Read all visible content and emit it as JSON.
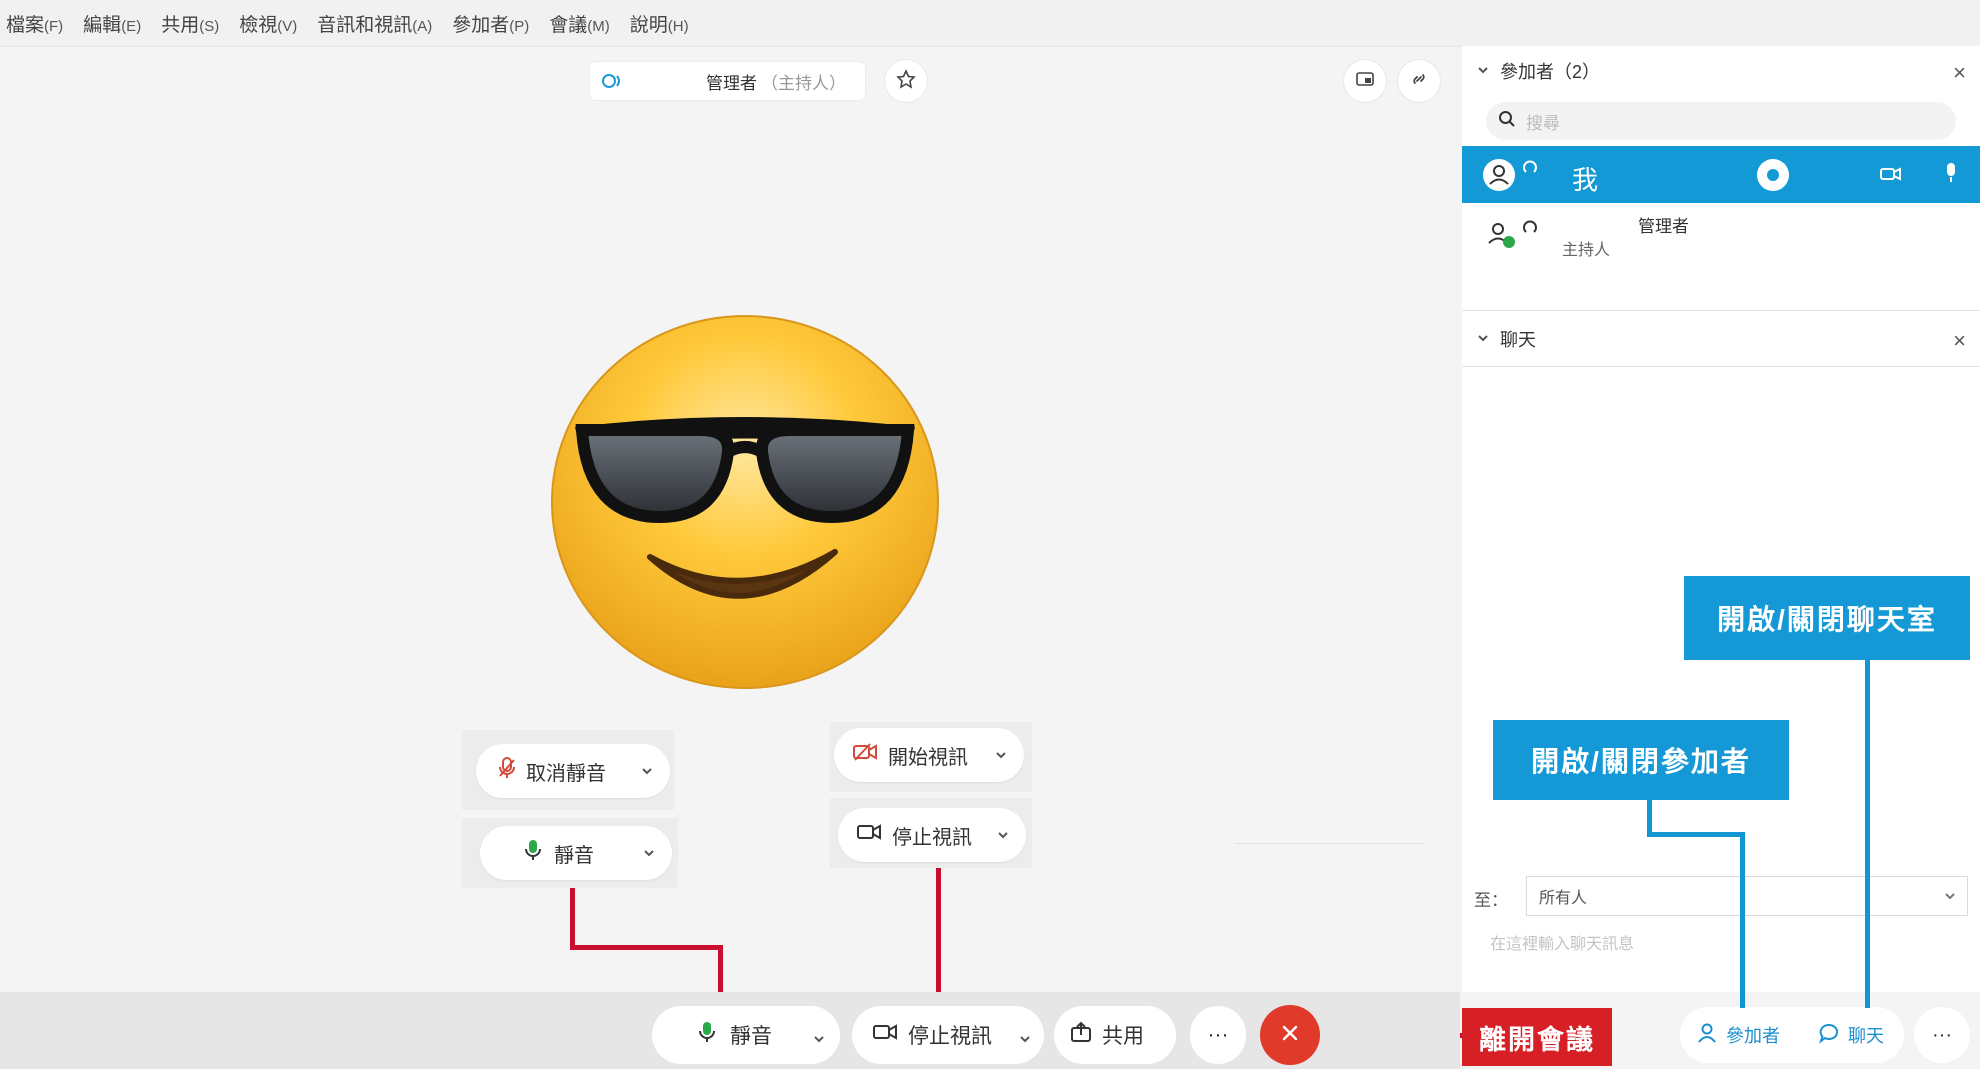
{
  "menu": [
    {
      "label": "檔案",
      "accel": "(F)"
    },
    {
      "label": "編輯",
      "accel": "(E)"
    },
    {
      "label": "共用",
      "accel": "(S)"
    },
    {
      "label": "檢視",
      "accel": "(V)"
    },
    {
      "label": "音訊和視訊",
      "accel": "(A)"
    },
    {
      "label": "參加者",
      "accel": "(P)"
    },
    {
      "label": "會議",
      "accel": "(M)"
    },
    {
      "label": "說明",
      "accel": "(H)"
    }
  ],
  "stage": {
    "speaker_name": "管理者",
    "speaker_role": "（主持人）"
  },
  "popups": {
    "unmute_label": "取消靜音",
    "mute_label": "靜音",
    "start_video_label": "開始視訊",
    "stop_video_label": "停止視訊"
  },
  "toolbar": {
    "mute_label": "靜音",
    "stop_video_label": "停止視訊",
    "share_label": "共用",
    "more_label": "···",
    "leave_icon": "close-icon",
    "participants_label": "參加者",
    "chat_label": "聊天",
    "more2_label": "···"
  },
  "callouts": {
    "leave": "離開會議",
    "toggle_chat": "開啟/關閉聊天室",
    "toggle_participants": "開啟/關閉參加者"
  },
  "participants_panel": {
    "title": "參加者（2）",
    "close": "×",
    "search_placeholder": "搜尋",
    "me_label": "我",
    "host_name": "管理者",
    "host_role": "主持人"
  },
  "chat_panel": {
    "title": "聊天",
    "close": "×",
    "to_label": "至：",
    "to_value": "所有人",
    "input_placeholder": "在這裡輸入聊天訊息"
  },
  "colors": {
    "accent_blue": "#1399d6",
    "callout_red": "#d71f26",
    "leave_red": "#e03a2a"
  }
}
